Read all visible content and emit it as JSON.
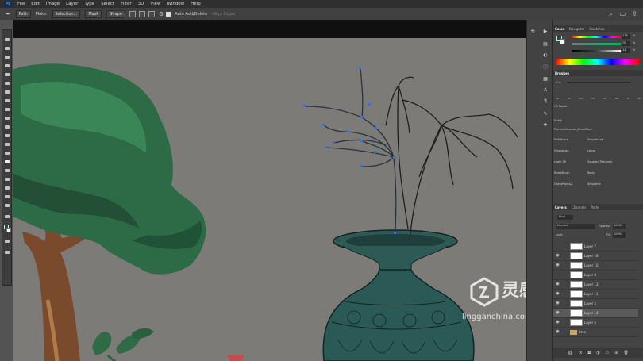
{
  "app": {
    "logo": "Ps"
  },
  "menu": [
    "File",
    "Edit",
    "Image",
    "Layer",
    "Type",
    "Select",
    "Filter",
    "3D",
    "View",
    "Window",
    "Help"
  ],
  "options": {
    "mode_label": "Path",
    "make_label": "Make:",
    "selection_label": "Selection...",
    "mask_label": "Mask",
    "shape_label": "Shape",
    "auto_add_delete_label": "Auto Add/Delete",
    "align_edges_label": "Align Edges",
    "right_icons": [
      "search-icon",
      "workspace-icon",
      "share-icon"
    ]
  },
  "color_panel": {
    "tabs": [
      "Color",
      "Navigator",
      "Swatches"
    ],
    "channels": [
      {
        "value": "176",
        "unit": "%"
      },
      {
        "value": "70",
        "unit": "%"
      },
      {
        "value": "14",
        "unit": "%"
      }
    ],
    "colors": {
      "foreground": "#1f4a3d",
      "background": "#ffffff"
    }
  },
  "brushes_panel": {
    "title": "Brushes",
    "size_label": "Size",
    "preset_sizes": [
      "10",
      "17",
      "13",
      "17",
      "14",
      "56",
      "4",
      "10"
    ],
    "group_header": "Oil Pastel",
    "first_brush": "Stitch",
    "brush_group": "PlenemCouchez_BrushPack",
    "brushes": [
      [
        "SoftRound",
        "SmoothSoft"
      ],
      [
        "Stepneues",
        "Lense"
      ],
      [
        "chalk 36",
        "Squared Textured"
      ],
      [
        "RulesBrush",
        "Rocky"
      ],
      [
        "GrassPlants2",
        "Smoothie"
      ]
    ]
  },
  "layers_panel": {
    "tabs": [
      "Layers",
      "Channels",
      "Paths"
    ],
    "kind_label": "Kind",
    "blend_mode": "Normal",
    "opacity_label": "Opacity:",
    "opacity_value": "100%",
    "lock_label": "Lock:",
    "fill_label": "Fill:",
    "fill_value": "100%",
    "layers": [
      {
        "name": "Layer 7",
        "visible": false
      },
      {
        "name": "Layer 16",
        "visible": true
      },
      {
        "name": "Layer 10",
        "visible": true
      },
      {
        "name": "Layer 8",
        "visible": false
      },
      {
        "name": "Layer 13",
        "visible": true
      },
      {
        "name": "Layer 11",
        "visible": true
      },
      {
        "name": "Layer 5",
        "visible": true
      },
      {
        "name": "Layer 14",
        "visible": true
      },
      {
        "name": "Layer 4",
        "visible": true
      },
      {
        "name": "tree",
        "visible": true
      }
    ]
  },
  "watermark": {
    "brand": "灵感中国",
    "url": "lingganchina.com"
  }
}
